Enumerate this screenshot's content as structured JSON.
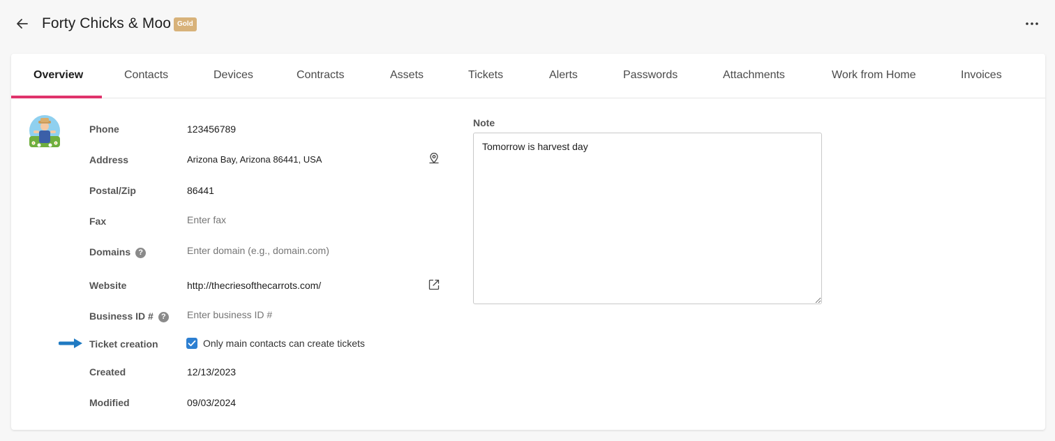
{
  "header": {
    "title": "Forty Chicks & Moo",
    "badge": "Gold",
    "badge_color": "#d8b27a"
  },
  "tabs": [
    {
      "label": "Overview",
      "active": true
    },
    {
      "label": "Contacts"
    },
    {
      "label": "Devices"
    },
    {
      "label": "Contracts"
    },
    {
      "label": "Assets"
    },
    {
      "label": "Tickets"
    },
    {
      "label": "Alerts"
    },
    {
      "label": "Passwords"
    },
    {
      "label": "Attachments"
    },
    {
      "label": "Work from Home"
    },
    {
      "label": "Invoices"
    }
  ],
  "accent_color": "#e0336b",
  "fields": {
    "phone": {
      "label": "Phone",
      "value": "123456789"
    },
    "address": {
      "label": "Address",
      "value": "Arizona Bay, Arizona 86441, USA",
      "icon": "map-pin-icon"
    },
    "postal": {
      "label": "Postal/Zip",
      "value": "86441"
    },
    "fax": {
      "label": "Fax",
      "placeholder": "Enter fax"
    },
    "domains": {
      "label": "Domains",
      "placeholder": "Enter domain (e.g., domain.com)"
    },
    "website": {
      "label": "Website",
      "value": "http://thecriesofthecarrots.com/",
      "icon": "external-link-icon"
    },
    "business_id": {
      "label": "Business ID #",
      "placeholder": "Enter business ID #"
    },
    "ticket_creation": {
      "label": "Ticket creation",
      "checkbox_label": "Only main contacts can create tickets",
      "checked": true
    },
    "created": {
      "label": "Created",
      "value": "12/13/2023"
    },
    "modified": {
      "label": "Modified",
      "value": "09/03/2024"
    }
  },
  "note": {
    "label": "Note",
    "value": "Tomorrow is harvest day"
  },
  "help_glyph": "?"
}
